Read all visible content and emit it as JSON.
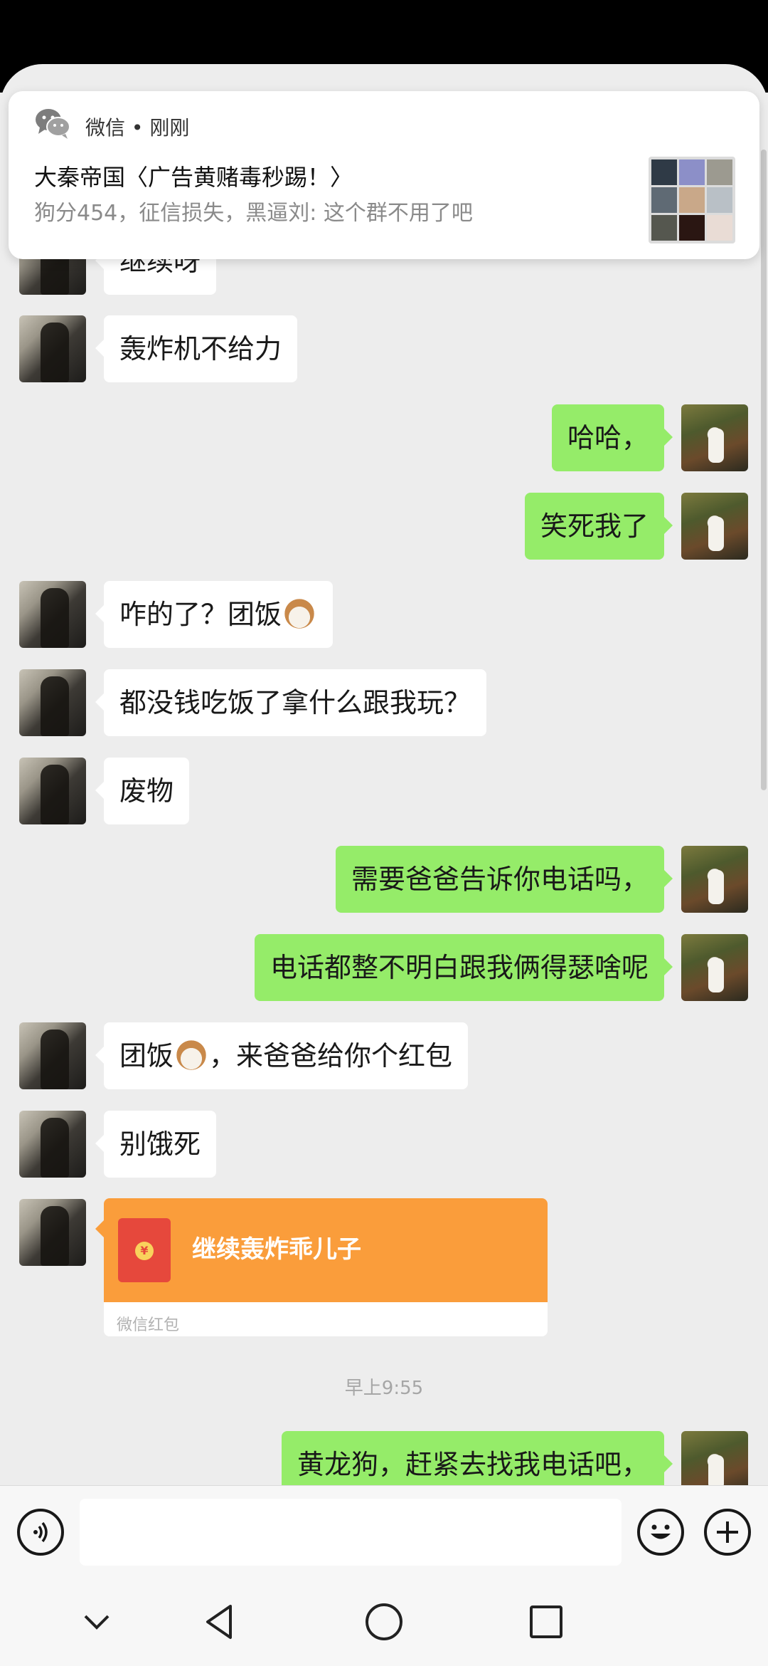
{
  "notification": {
    "app_line": "微信 • 刚刚",
    "title": "大秦帝国〈广告黄赌毒秒踢！〉",
    "body": "狗分454，征信损失，黑逼刘: 这个群不用了吧"
  },
  "messages": {
    "m0": "继续呀",
    "m1": "轰炸机不给力",
    "m2": "哈哈，",
    "m3": "笑死我了",
    "m4": "咋的了？团饭",
    "m5": "都没钱吃饭了拿什么跟我玩？",
    "m6": "废物",
    "m7": "需要爸爸告诉你电话吗，",
    "m8": "电话都整不明白跟我俩得瑟啥呢",
    "m9a": "团饭",
    "m9b": "，来爸爸给你个红包",
    "m10": "别饿死",
    "m11": "黄龙狗，赶紧去找我电话吧，"
  },
  "red_packet": {
    "title": "继续轰炸乖儿子",
    "footer": "微信红包",
    "coin_symbol": "¥"
  },
  "timestamp": "早上9:55",
  "icons": {
    "voice": "voice-icon",
    "emoji": "emoji-icon",
    "plus": "plus-icon",
    "back": "back-icon",
    "home": "home-icon",
    "recents": "recents-icon"
  },
  "colors": {
    "outgoing_bubble": "#95ec69",
    "incoming_bubble": "#ffffff",
    "red_packet": "#fa9d3b",
    "background": "#ededed"
  }
}
